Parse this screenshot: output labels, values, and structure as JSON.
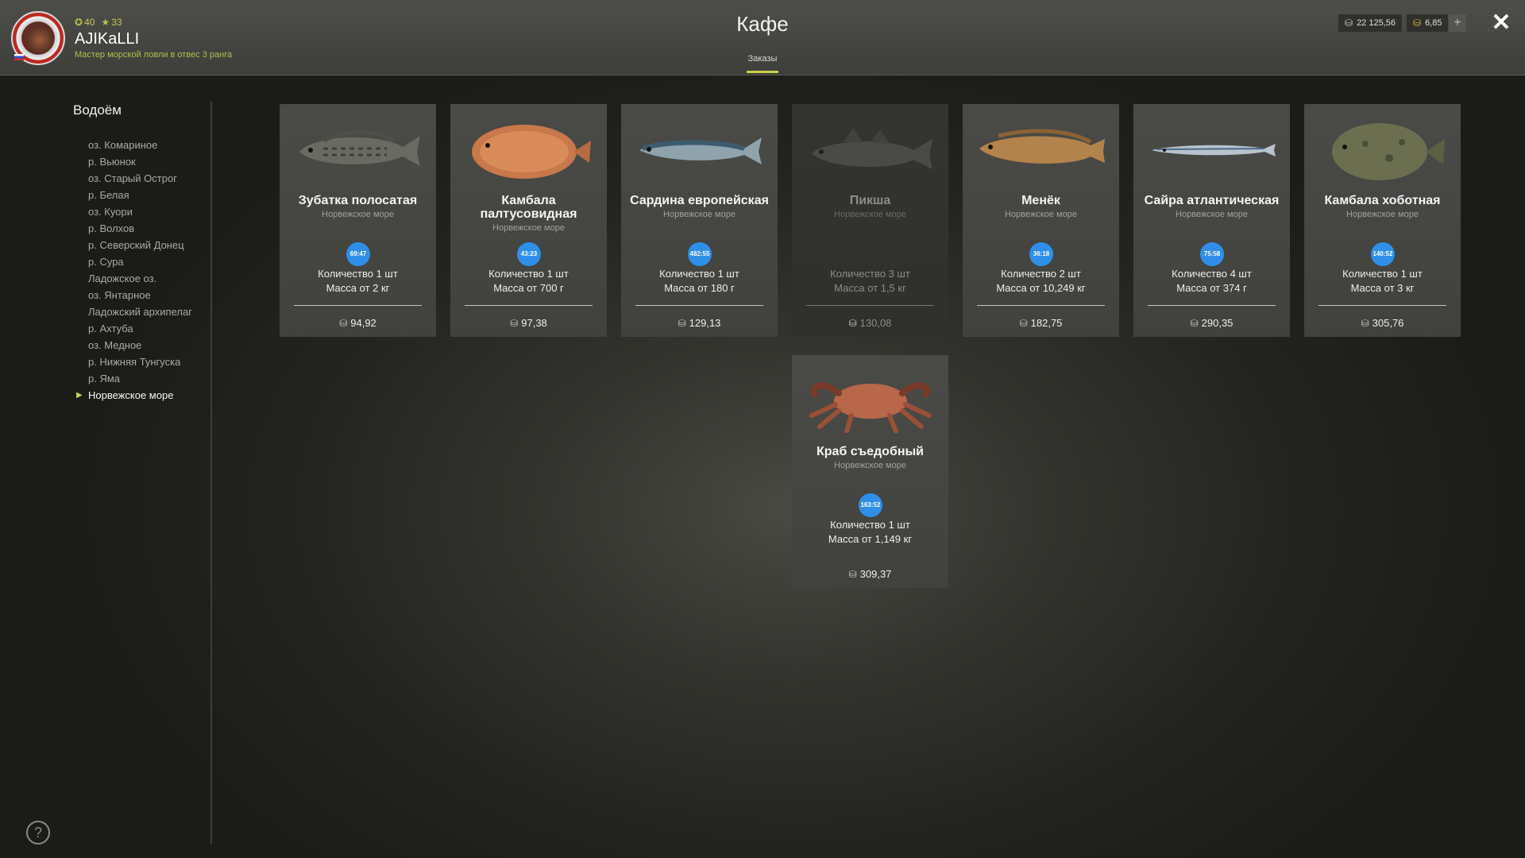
{
  "header": {
    "title": "Кафе",
    "tab": "Заказы",
    "player": {
      "name": "AJIKaLLI",
      "stat1": "40",
      "stat2": "33",
      "rank": "Мастер морской ловли в отвес 3 ранга"
    },
    "currency": {
      "silver": "22 125,56",
      "gold": "6,85"
    },
    "add_label": "+",
    "close_label": "✕"
  },
  "sidebar": {
    "title": "Водоём",
    "items": [
      {
        "label": "оз. Комариное"
      },
      {
        "label": "р. Вьюнок"
      },
      {
        "label": "оз. Старый Острог"
      },
      {
        "label": "р. Белая"
      },
      {
        "label": "оз. Куори"
      },
      {
        "label": "р. Волхов"
      },
      {
        "label": "р. Северский Донец"
      },
      {
        "label": "р. Сура"
      },
      {
        "label": "Ладожское оз."
      },
      {
        "label": "оз. Янтарное"
      },
      {
        "label": "Ладожский архипелаг"
      },
      {
        "label": "р. Ахтуба"
      },
      {
        "label": "оз. Медное"
      },
      {
        "label": "р. Нижняя Тунгуска"
      },
      {
        "label": "р. Яма"
      },
      {
        "label": "Норвежское море",
        "active": true
      }
    ]
  },
  "help_label": "?",
  "orders": [
    {
      "name": "Зубатка полосатая",
      "region": "Норвежское море",
      "timer": "69:47",
      "qty": "Количество 1 шт",
      "mass": "Масса от 2 кг",
      "price": "94,92",
      "icon": "wolffish-icon"
    },
    {
      "name": "Камбала палтусовидная",
      "region": "Норвежское море",
      "timer": "43:23",
      "qty": "Количество 1 шт",
      "mass": "Масса от 700 г",
      "price": "97,38",
      "icon": "flounder-icon"
    },
    {
      "name": "Сардина европейская",
      "region": "Норвежское море",
      "timer": "482:55",
      "qty": "Количество 1 шт",
      "mass": "Масса от 180 г",
      "price": "129,13",
      "icon": "sardine-icon"
    },
    {
      "name": "Пикша",
      "region": "Норвежское море",
      "timer": "",
      "qty": "Количество 3 шт",
      "mass": "Масса от 1,5 кг",
      "price": "130,08",
      "icon": "haddock-icon",
      "dim": true
    },
    {
      "name": "Менёк",
      "region": "Норвежское море",
      "timer": "36:18",
      "qty": "Количество 2 шт",
      "mass": "Масса от 10,249 кг",
      "price": "182,75",
      "icon": "tusk-icon"
    },
    {
      "name": "Сайра атлантическая",
      "region": "Норвежское море",
      "timer": "75:58",
      "qty": "Количество 4 шт",
      "mass": "Масса от 374 г",
      "price": "290,35",
      "icon": "saury-icon"
    },
    {
      "name": "Камбала хоботная",
      "region": "Норвежское море",
      "timer": "140:52",
      "qty": "Количество 1 шт",
      "mass": "Масса от 3 кг",
      "price": "305,76",
      "icon": "plaice-icon"
    },
    {
      "name": "Краб съедобный",
      "region": "Норвежское море",
      "timer": "163:52",
      "qty": "Количество 1 шт",
      "mass": "Масса от 1,149 кг",
      "price": "309,37",
      "icon": "crab-icon"
    }
  ]
}
